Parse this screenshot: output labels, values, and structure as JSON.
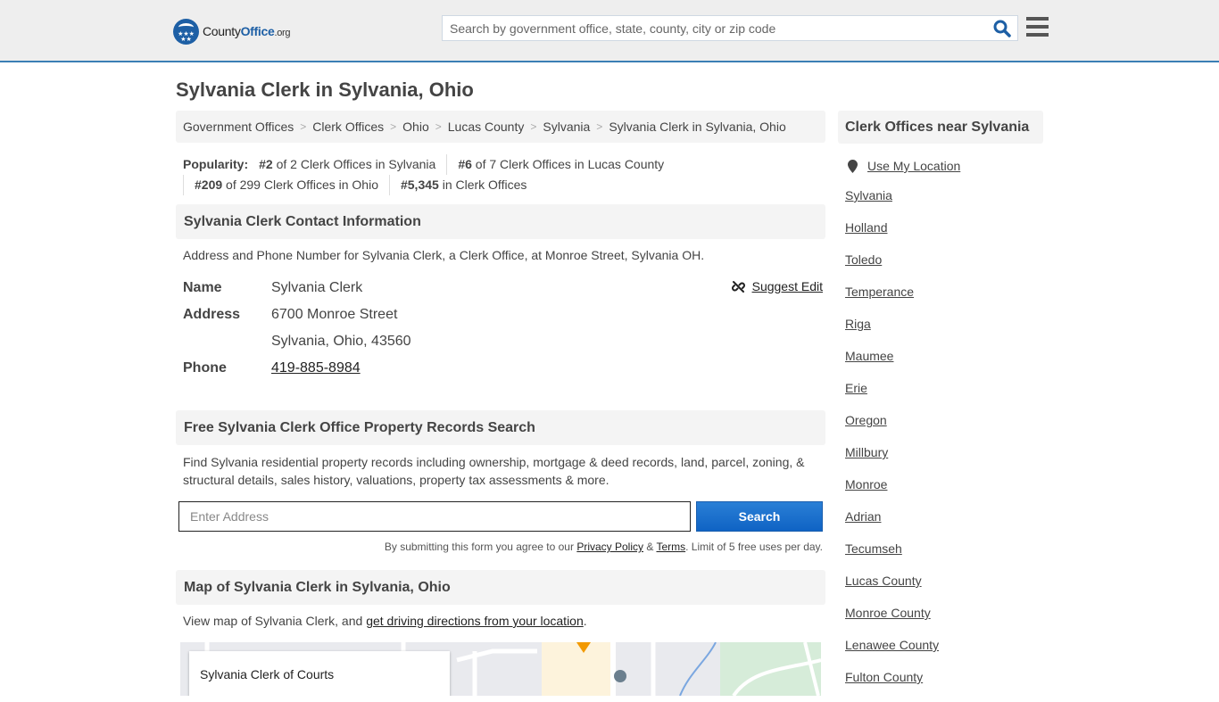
{
  "header": {
    "logo": {
      "prefix": "County",
      "brand": "Office",
      "tld": ".org"
    },
    "search_placeholder": "Search by government office, state, county, city or zip code",
    "search_icon": "search-icon",
    "menu_icon": "hamburger-menu-icon",
    "accent_color": "#3a7fb5"
  },
  "page_title": "Sylvania Clerk in Sylvania, Ohio",
  "breadcrumb": [
    "Government Offices",
    "Clerk Offices",
    "Ohio",
    "Lucas County",
    "Sylvania",
    "Sylvania Clerk in Sylvania, Ohio"
  ],
  "popularity": {
    "label": "Popularity:",
    "items": [
      {
        "rank": "#2",
        "text": " of 2 Clerk Offices in Sylvania"
      },
      {
        "rank": "#6",
        "text": " of 7 Clerk Offices in Lucas County"
      },
      {
        "rank": "#209",
        "text": " of 299 Clerk Offices in Ohio"
      },
      {
        "rank": "#5,345",
        "text": " in Clerk Offices"
      }
    ]
  },
  "contact": {
    "heading": "Sylvania Clerk Contact Information",
    "description": "Address and Phone Number for Sylvania Clerk, a Clerk Office, at Monroe Street, Sylvania OH.",
    "suggest_edit": "Suggest Edit",
    "name_label": "Name",
    "name": "Sylvania Clerk",
    "address_label": "Address",
    "address_line1": "6700 Monroe Street",
    "address_line2": "Sylvania, Ohio, 43560",
    "phone_label": "Phone",
    "phone": "419-885-8984"
  },
  "property": {
    "heading": "Free Sylvania Clerk Office Property Records Search",
    "description": "Find Sylvania residential property records including ownership, mortgage & deed records, land, parcel, zoning, & structural details, sales history, valuations, property tax assessments & more.",
    "input_placeholder": "Enter Address",
    "button_label": "Search",
    "button_color": "#1565c0",
    "disclaimer_prefix": "By submitting this form you agree to our ",
    "privacy_link": "Privacy Policy",
    "amp": " & ",
    "terms_link": "Terms",
    "disclaimer_suffix": ". Limit of 5 free uses per day."
  },
  "map": {
    "heading": "Map of Sylvania Clerk in Sylvania, Ohio",
    "desc_prefix": "View map of Sylvania Clerk, and ",
    "directions_link": "get driving directions from your location",
    "desc_suffix": ".",
    "card_title": "Sylvania Clerk of Courts"
  },
  "sidebar": {
    "heading": "Clerk Offices near Sylvania",
    "use_location": "Use My Location",
    "links": [
      "Sylvania",
      "Holland",
      "Toledo",
      "Temperance",
      "Riga",
      "Maumee",
      "Erie",
      "Oregon",
      "Millbury",
      "Monroe",
      "Adrian",
      "Tecumseh",
      "Lucas County",
      "Monroe County",
      "Lenawee County",
      "Fulton County"
    ]
  }
}
